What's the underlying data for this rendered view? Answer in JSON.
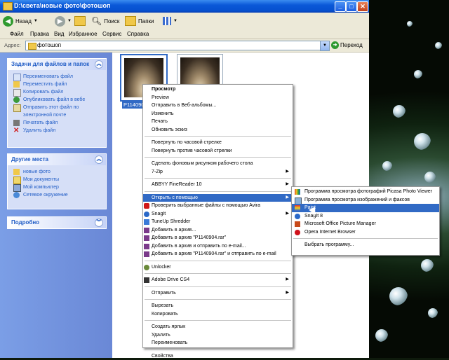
{
  "window": {
    "title": "D:\\света\\новые фото\\фотошоп",
    "buttons": {
      "minimize": "_",
      "maximize": "□",
      "close": "✕"
    }
  },
  "toolbar": {
    "back": "Назад",
    "search": "Поиск",
    "folders": "Папки"
  },
  "menubar": [
    "Файл",
    "Правка",
    "Вид",
    "Избранное",
    "Сервис",
    "Справка"
  ],
  "address": {
    "label": "Адрес:",
    "value": "фотошоп",
    "go": "Переход"
  },
  "leftpane": {
    "tasks": {
      "title": "Задачи для файлов и папок",
      "items": [
        "Переименовать файл",
        "Переместить файл",
        "Копировать файл",
        "Опубликовать файл в вебе",
        "Отправить этот файл по",
        "электронной почте",
        "Печатать файл",
        "Удалить файл"
      ]
    },
    "places": {
      "title": "Другие места",
      "items": [
        "новые фото",
        "Мои документы",
        "Мой компьютер",
        "Сетевое окружение"
      ]
    },
    "details": {
      "title": "Подробно"
    }
  },
  "files": {
    "selected_name": "P1140904",
    "second_name": ""
  },
  "context_menu": {
    "items": [
      {
        "label": "Просмотр",
        "bold": true
      },
      {
        "label": "Preview"
      },
      {
        "label": "Отправить в Веб-альбомы..."
      },
      {
        "label": "Изменить"
      },
      {
        "label": "Печать"
      },
      {
        "label": "Обновить эскиз"
      },
      {
        "sep": true
      },
      {
        "label": "Повернуть по часовой стрелке"
      },
      {
        "label": "Повернуть против часовой стрелки"
      },
      {
        "sep": true
      },
      {
        "label": "Сделать фоновым рисунком рабочего стола"
      },
      {
        "label": "7-Zip",
        "submenu": true
      },
      {
        "sep": true
      },
      {
        "label": "ABBYY FineReader 10",
        "submenu": true
      },
      {
        "sep": true
      },
      {
        "label": "Открыть с помощью",
        "submenu": true,
        "highlighted": true
      },
      {
        "label": "Проверить выбранные файлы с помощью Avira",
        "icon": "avira"
      },
      {
        "label": "SnagIt",
        "submenu": true,
        "icon": "snagit"
      },
      {
        "label": "TuneUp Shredder",
        "icon": "tuneup"
      },
      {
        "label": "Добавить в архив...",
        "icon": "rar"
      },
      {
        "label": "Добавить в архив \"P1140904.rar\"",
        "icon": "rar"
      },
      {
        "label": "Добавить в архив и отправить по e-mail...",
        "icon": "rar"
      },
      {
        "label": "Добавить в архив \"P1140904.rar\" и отправить по e-mail",
        "icon": "rar"
      },
      {
        "sep": true
      },
      {
        "label": "Unlocker",
        "icon": "unlocker"
      },
      {
        "sep": true
      },
      {
        "label": "Adobe Drive CS4",
        "submenu": true,
        "icon": "adobe"
      },
      {
        "sep": true
      },
      {
        "label": "Отправить",
        "submenu": true
      },
      {
        "sep": true
      },
      {
        "label": "Вырезать"
      },
      {
        "label": "Копировать"
      },
      {
        "sep": true
      },
      {
        "label": "Создать ярлык"
      },
      {
        "label": "Удалить"
      },
      {
        "label": "Переименовать"
      },
      {
        "sep": true
      },
      {
        "label": "Свойства"
      }
    ]
  },
  "open_with_menu": {
    "items": [
      {
        "label": "Программа просмотра фотографий Picasa Photo Viewer",
        "icon": "picasa"
      },
      {
        "label": "Программа просмотра изображений и факсов",
        "icon": "viewer"
      },
      {
        "label": "Paint",
        "icon": "paint",
        "highlighted": true
      },
      {
        "label": "SnagIt 8",
        "icon": "snagit"
      },
      {
        "label": "Microsoft Office Picture Manager",
        "icon": "office"
      },
      {
        "label": "Opera Internet Browser",
        "icon": "opera"
      },
      {
        "sep": true
      },
      {
        "label": "Выбрать программу..."
      }
    ]
  },
  "colors": {
    "title_bar": "#0a58d8",
    "highlight": "#316ac5",
    "left_pane": "#7b9ee6",
    "link": "#215dc6"
  }
}
